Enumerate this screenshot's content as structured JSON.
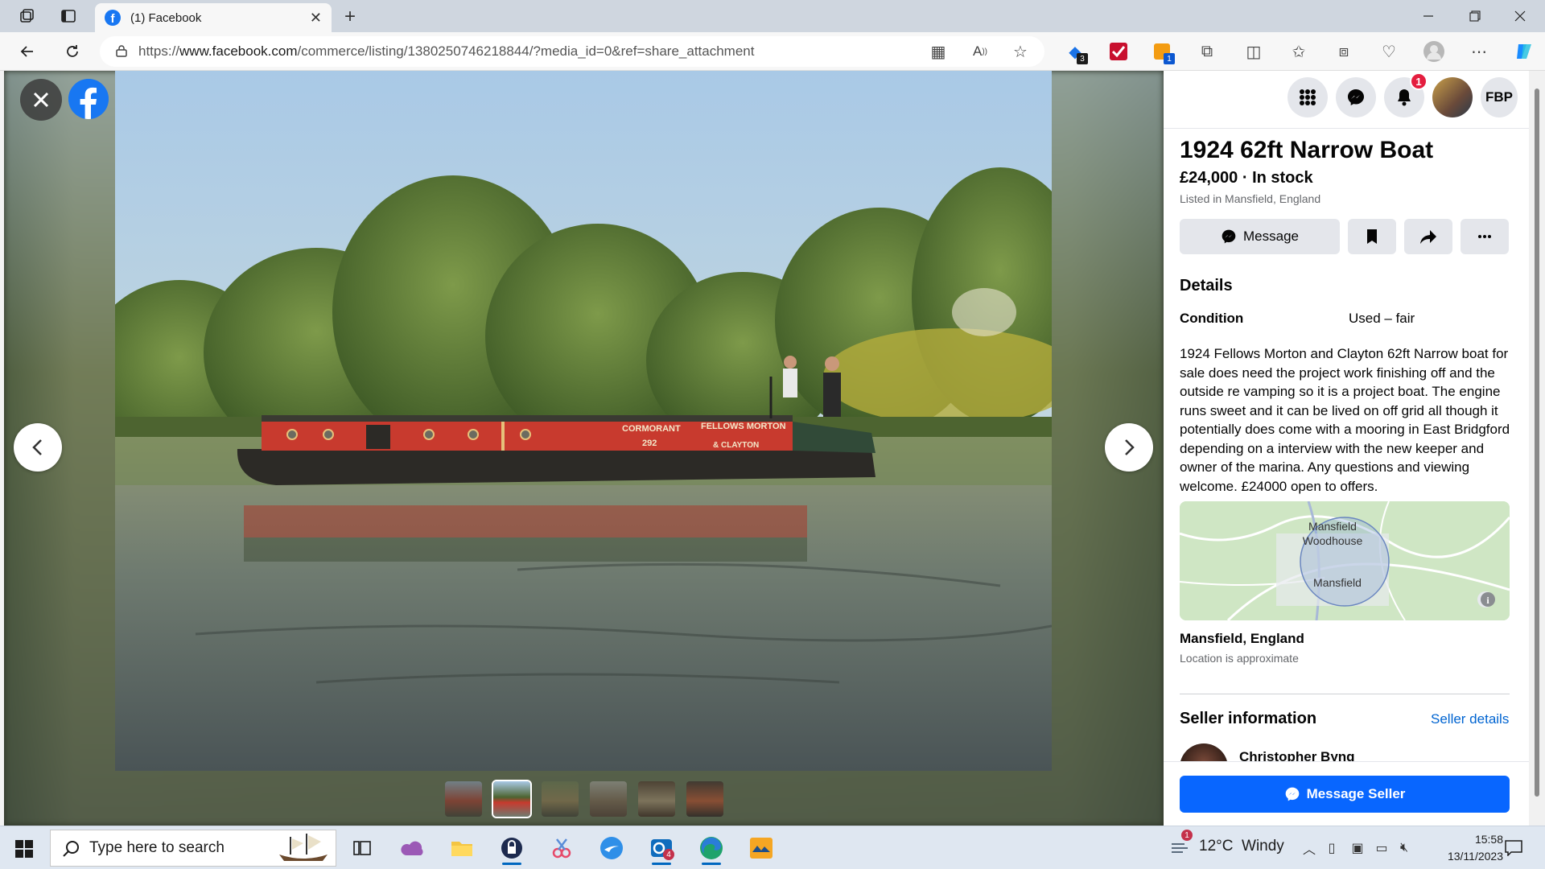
{
  "browser": {
    "tab_title": "(1) Facebook",
    "url_prefix": "https://",
    "url_host": "www.facebook.com",
    "url_path": "/commerce/listing/1380250746218844/?media_id=0&ref=share_attachment",
    "extension_badges": [
      "3",
      "1"
    ]
  },
  "header": {
    "notification_count": "1",
    "profile_initials": "FBP"
  },
  "listing": {
    "title": "1924 62ft Narrow Boat",
    "price_status": "£24,000 · In stock",
    "listed_in": "Listed in Mansfield, England",
    "message_label": "Message",
    "details_heading": "Details",
    "condition_label": "Condition",
    "condition_value": "Used – fair",
    "description": "1924 Fellows Morton and Clayton 62ft Narrow boat for sale does need the project work finishing off and the outside re vamping so it is a project boat. The engine runs sweet and it can be lived on off grid all though it potentially does come with a mooring in East Bridgford depending on a interview with the new keeper and owner of the marina. Any questions and viewing welcome.  £24000 open to offers.",
    "map_labels": [
      "Mansfield",
      "Woodhouse",
      "Mansfield"
    ],
    "location_name": "Mansfield, England",
    "location_note": "Location is approximate",
    "seller_heading": "Seller information",
    "seller_details_link": "Seller details",
    "seller_name": "Christopher Byng",
    "message_seller_label": "Message Seller"
  },
  "photo": {
    "boat_text": [
      "CORMORANT",
      "292",
      "FELLOWS MORTON",
      "&",
      "& CLAYTON"
    ],
    "thumbnail_count": 6,
    "active_thumbnail": 2
  },
  "taskbar": {
    "search_placeholder": "Type here to search",
    "weather_text": "12°C  Windy",
    "weather_badge": "1",
    "mail_badge": "4",
    "time": "15:58",
    "date": "13/11/2023"
  },
  "colors": {
    "facebook_blue": "#1877f2",
    "button_blue": "#0866ff",
    "link_blue": "#0064d1",
    "badge_red": "#e41e3f",
    "secondary_text": "#65676b"
  }
}
